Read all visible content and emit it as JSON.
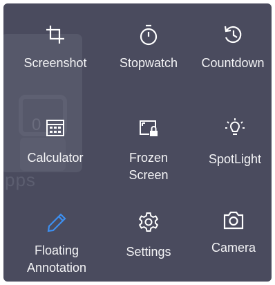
{
  "background": {
    "faint_text": "pps",
    "faint_number": "0"
  },
  "tiles": [
    {
      "label": "Screenshot",
      "icon": "crop-icon",
      "color": "#ffffff"
    },
    {
      "label": "Stopwatch",
      "icon": "stopwatch-icon",
      "color": "#ffffff"
    },
    {
      "label": "Countdown",
      "icon": "history-icon",
      "color": "#ffffff"
    },
    {
      "label": "Calculator",
      "icon": "calculator-icon",
      "color": "#ffffff"
    },
    {
      "label_line1": "Frozen",
      "label_line2": "Screen",
      "icon": "frozen-screen-icon",
      "color": "#ffffff"
    },
    {
      "label": "SpotLight",
      "icon": "lightbulb-icon",
      "color": "#ffffff"
    },
    {
      "label_line1": "Floating",
      "label_line2": "Annotation",
      "icon": "pencil-icon",
      "color": "#3d8ff0"
    },
    {
      "label": "Settings",
      "icon": "gear-icon",
      "color": "#ffffff"
    },
    {
      "label": "Camera",
      "icon": "camera-icon",
      "color": "#ffffff"
    }
  ]
}
